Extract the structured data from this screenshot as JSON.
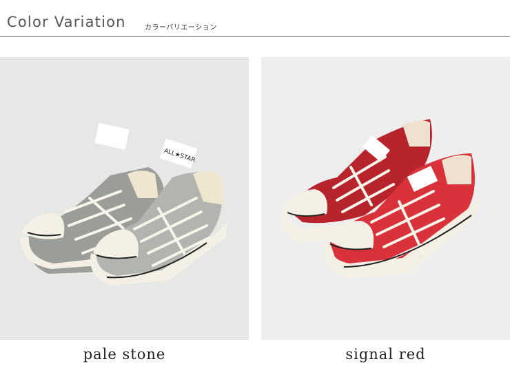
{
  "header": {
    "title": "Color Variation",
    "subtitle": "カラーバリエーション"
  },
  "variations": [
    {
      "label": "pale stone",
      "shoe_color": "#b3b3b0",
      "shade_color": "#9c9c98",
      "background": "#e7e7e5"
    },
    {
      "label": "signal red",
      "shoe_color": "#d9323a",
      "shade_color": "#b8242c",
      "background": "#eeeeef"
    }
  ],
  "patch_text": "ALL★STAR"
}
